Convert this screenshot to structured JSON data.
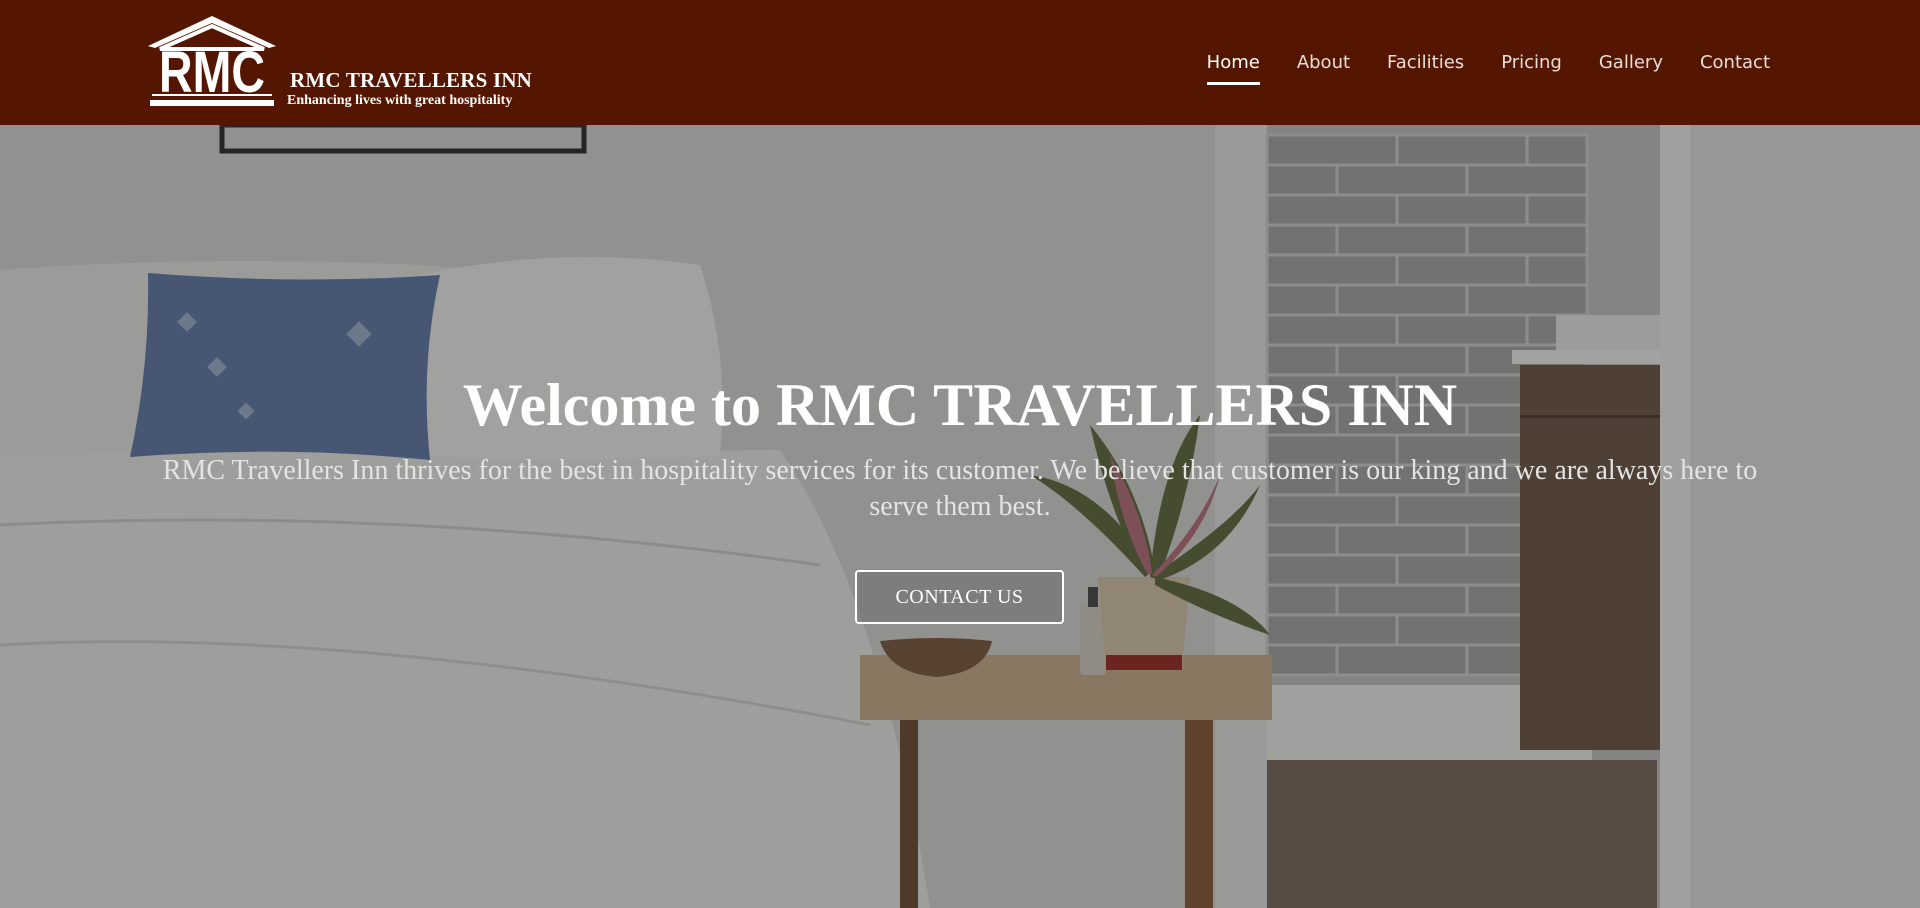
{
  "brand": {
    "name": "RMC TRAVELLERS INN",
    "tagline": "Enhancing lives with great hospitality",
    "logo_text": "RMC"
  },
  "nav": {
    "items": [
      {
        "label": "Home",
        "active": true
      },
      {
        "label": "About",
        "active": false
      },
      {
        "label": "Facilities",
        "active": false
      },
      {
        "label": "Pricing",
        "active": false
      },
      {
        "label": "Gallery",
        "active": false
      },
      {
        "label": "Contact",
        "active": false
      }
    ]
  },
  "hero": {
    "title": "Welcome to RMC TRAVELLERS INN",
    "text": "RMC Travellers Inn thrives for the best in hospitality services for its customer. We believe that customer is our king and we are always here to serve them best.",
    "button_label": "CONTACT US"
  },
  "colors": {
    "header_bg": "#541600",
    "text_light": "#ffffff"
  }
}
